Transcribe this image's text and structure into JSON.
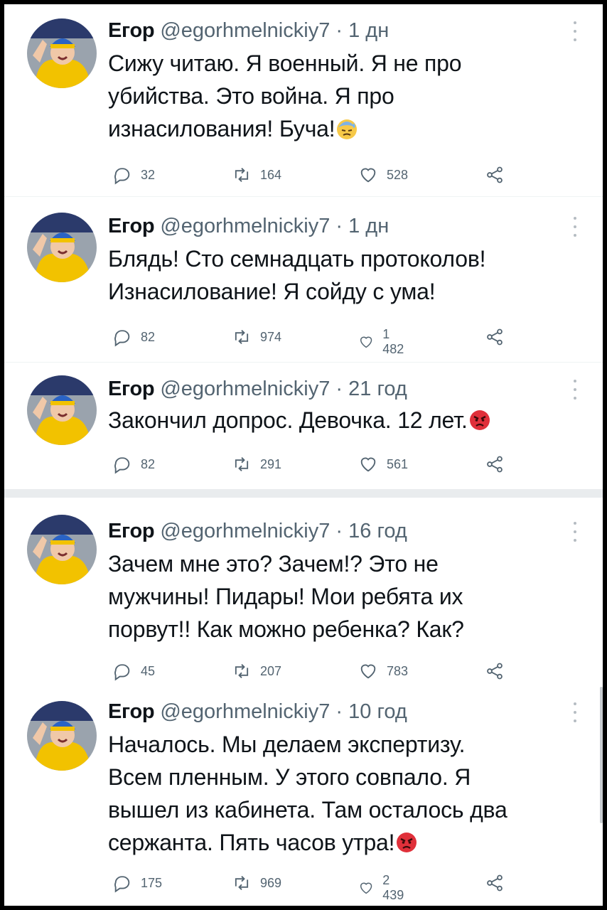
{
  "colors": {
    "text": "#0f1419",
    "secondary": "#536471",
    "divider": "#eff3f4"
  },
  "icons": [
    "reply-icon",
    "retweet-icon",
    "like-icon",
    "share-icon",
    "more-icon"
  ],
  "tweets": [
    {
      "name": "Егор",
      "handle": "@egorhmelnickiy7",
      "dot": "·",
      "time": "1 дн",
      "lines": [
        "Сижу читаю. Я военный. Я не про",
        "убийства. Это война. Я про",
        "изнасилования! Буча!"
      ],
      "emoji": "downcast-sweat-emoji",
      "reply": "32",
      "retweet": "164",
      "like": "528"
    },
    {
      "name": "Егор",
      "handle": "@egorhmelnickiy7",
      "dot": "·",
      "time": "1 дн",
      "lines": [
        "Блядь! Сто семнадцать протоколов!",
        "Изнасилование! Я сойду с ума!"
      ],
      "emoji": "",
      "reply": "82",
      "retweet": "974",
      "like": "1 482"
    },
    {
      "name": "Егор",
      "handle": "@egorhmelnickiy7",
      "dot": "·",
      "time": "21 год",
      "lines": [
        "Закончил допрос. Девочка. 12 лет."
      ],
      "emoji": "angry-face-emoji",
      "reply": "82",
      "retweet": "291",
      "like": "561"
    },
    {
      "name": "Егор",
      "handle": "@egorhmelnickiy7",
      "dot": "·",
      "time": "16 год",
      "lines": [
        "Зачем мне это? Зачем!? Это не",
        "мужчины! Пидары! Мои ребята их",
        "порвут!! Как можно ребенка? Как?"
      ],
      "emoji": "",
      "reply": "45",
      "retweet": "207",
      "like": "783"
    },
    {
      "name": "Егор",
      "handle": "@egorhmelnickiy7",
      "dot": "·",
      "time": "10 год",
      "lines": [
        "Началось. Мы делаем экспертизу.",
        "Всем пленным. У этого совпало. Я",
        "вышел из кабинета. Там осталось два",
        "сержанта. Пять часов утра!"
      ],
      "emoji": "angry-face-emoji",
      "reply": "175",
      "retweet": "969",
      "like": "2 439"
    }
  ]
}
